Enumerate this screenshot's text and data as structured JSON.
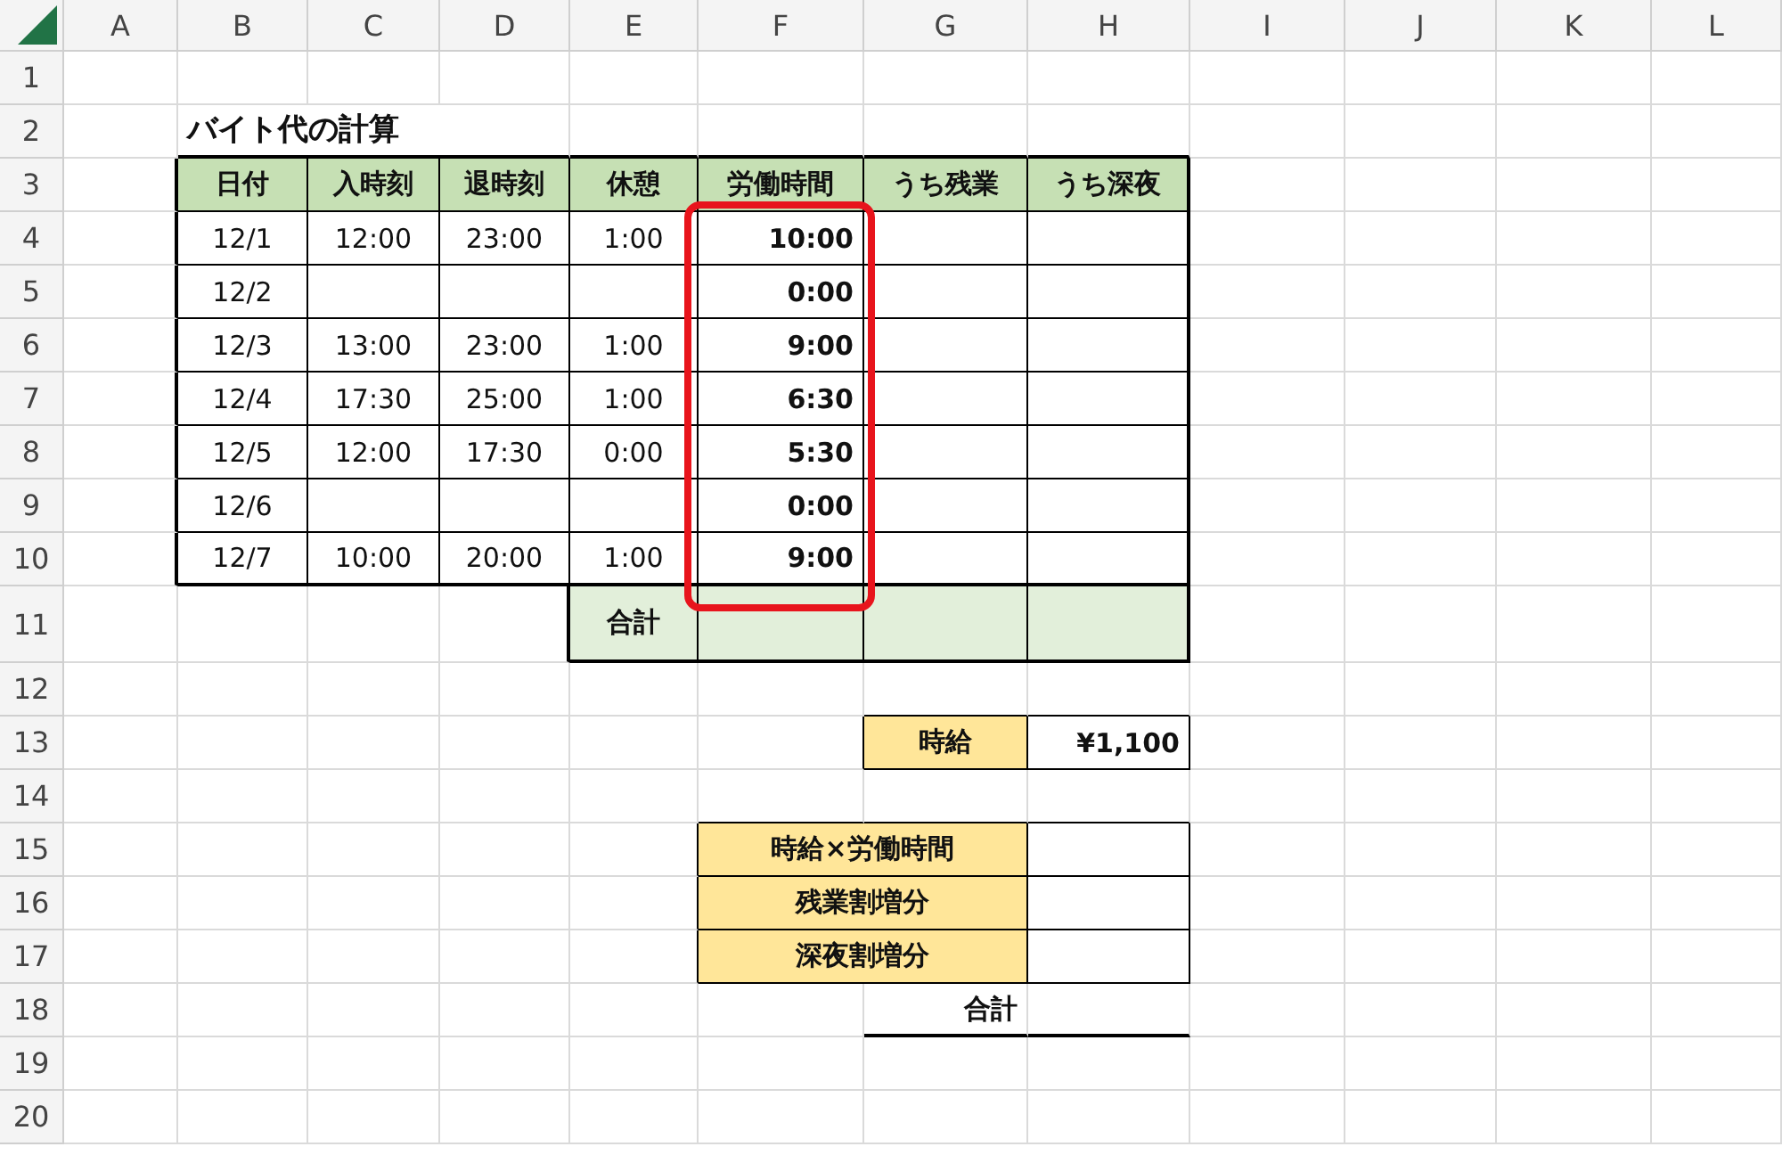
{
  "sheet": {
    "column_headers": [
      "A",
      "B",
      "C",
      "D",
      "E",
      "F",
      "G",
      "H",
      "I",
      "J",
      "K",
      "L"
    ],
    "row_headers": [
      "1",
      "2",
      "3",
      "4",
      "5",
      "6",
      "7",
      "8",
      "9",
      "10",
      "11",
      "12",
      "13",
      "14",
      "15",
      "16",
      "17",
      "18",
      "19",
      "20"
    ]
  },
  "title": "バイト代の計算",
  "work_table": {
    "columns": [
      "日付",
      "入時刻",
      "退時刻",
      "休憩",
      "労働時間",
      "うち残業",
      "うち深夜"
    ],
    "rows": [
      {
        "date": "12/1",
        "start": "12:00",
        "end": "23:00",
        "break": "1:00",
        "hours": "10:00"
      },
      {
        "date": "12/2",
        "hours": "0:00"
      },
      {
        "date": "12/3",
        "start": "13:00",
        "end": "23:00",
        "break": "1:00",
        "hours": "9:00"
      },
      {
        "date": "12/4",
        "start": "17:30",
        "end": "25:00",
        "break": "1:00",
        "hours": "6:30"
      },
      {
        "date": "12/5",
        "start": "12:00",
        "end": "17:30",
        "break": "0:00",
        "hours": "5:30"
      },
      {
        "date": "12/6",
        "hours": "0:00"
      },
      {
        "date": "12/7",
        "start": "10:00",
        "end": "20:00",
        "break": "1:00",
        "hours": "9:00"
      }
    ],
    "total_label": "合計"
  },
  "hourly_wage": {
    "label": "時給",
    "value": "¥1,100"
  },
  "pay_breakdown": {
    "items": [
      "時給×労働時間",
      "残業割増分",
      "深夜割増分"
    ],
    "total_label": "合計"
  }
}
